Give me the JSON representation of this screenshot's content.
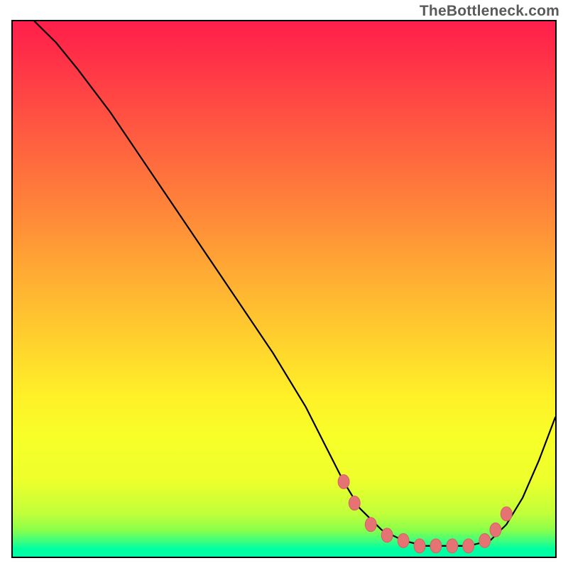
{
  "watermark": "TheBottleneck.com",
  "chart_data": {
    "type": "line",
    "title": "",
    "xlabel": "",
    "ylabel": "",
    "xlim": [
      0,
      100
    ],
    "ylim": [
      0,
      100
    ],
    "grid": false,
    "legend": false,
    "description": "Bottleneck curve over rainbow gradient background; curve descends sharply from top-left, flattens near x≈62–88% at y≈0–4%, then rises toward the right edge.",
    "series": [
      {
        "name": "bottleneck-curve",
        "x": [
          4,
          8,
          12,
          18,
          24,
          30,
          36,
          42,
          48,
          54,
          58,
          61,
          64,
          68,
          72,
          76,
          80,
          84,
          88,
          91,
          94,
          97,
          100
        ],
        "y": [
          100,
          96,
          91,
          83,
          74,
          65,
          56,
          47,
          38,
          28,
          20,
          14,
          9,
          5,
          3,
          2,
          2,
          2,
          3,
          6,
          11,
          18,
          26
        ]
      }
    ],
    "markers": {
      "name": "highlight-dots",
      "color": "#e57373",
      "points": [
        {
          "x": 61,
          "y": 14
        },
        {
          "x": 63,
          "y": 10
        },
        {
          "x": 66,
          "y": 6
        },
        {
          "x": 69,
          "y": 4
        },
        {
          "x": 72,
          "y": 3
        },
        {
          "x": 75,
          "y": 2
        },
        {
          "x": 78,
          "y": 2
        },
        {
          "x": 81,
          "y": 2
        },
        {
          "x": 84,
          "y": 2
        },
        {
          "x": 87,
          "y": 3
        },
        {
          "x": 89,
          "y": 5
        },
        {
          "x": 91,
          "y": 8
        }
      ]
    }
  }
}
